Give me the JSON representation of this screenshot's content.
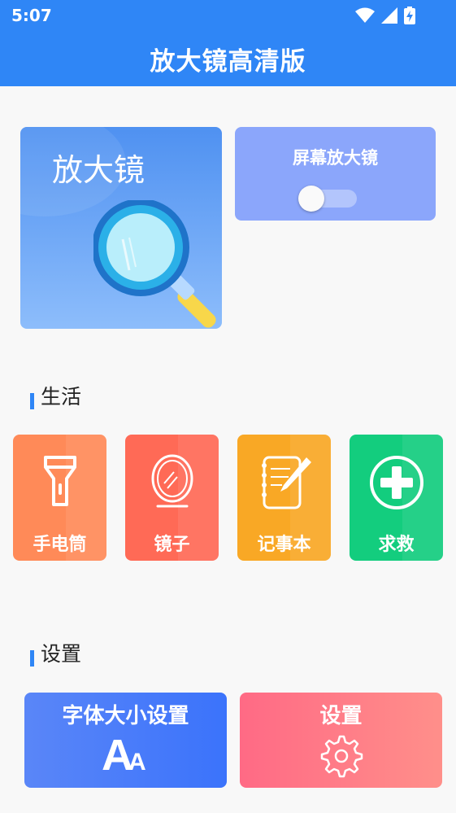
{
  "status_bar": {
    "time": "5:07",
    "icons": [
      "wifi-icon",
      "signal-icon",
      "battery-charging-icon"
    ]
  },
  "header": {
    "title": "放大镜高清版",
    "color": "#2f86f6"
  },
  "top_cards": {
    "magnifier": {
      "label": "放大镜"
    },
    "screen_magnifier": {
      "label": "屏幕放大镜",
      "toggle_on": false
    }
  },
  "sections": {
    "life": {
      "title": "生活"
    },
    "settings": {
      "title": "设置"
    }
  },
  "life_tiles": [
    {
      "label": "手电筒",
      "icon": "flashlight-icon",
      "color": "#ff8a58"
    },
    {
      "label": "镜子",
      "icon": "mirror-icon",
      "color": "#ff6a56"
    },
    {
      "label": "记事本",
      "icon": "notebook-icon",
      "color": "#f9a825"
    },
    {
      "label": "求救",
      "icon": "sos-plus-icon",
      "color": "#13cd7e"
    }
  ],
  "settings_buttons": {
    "font_size": {
      "label": "字体大小设置",
      "icon": "font-size-icon",
      "icon_text_big": "A",
      "icon_text_small": "A"
    },
    "settings": {
      "label": "设置",
      "icon": "gear-icon"
    }
  }
}
